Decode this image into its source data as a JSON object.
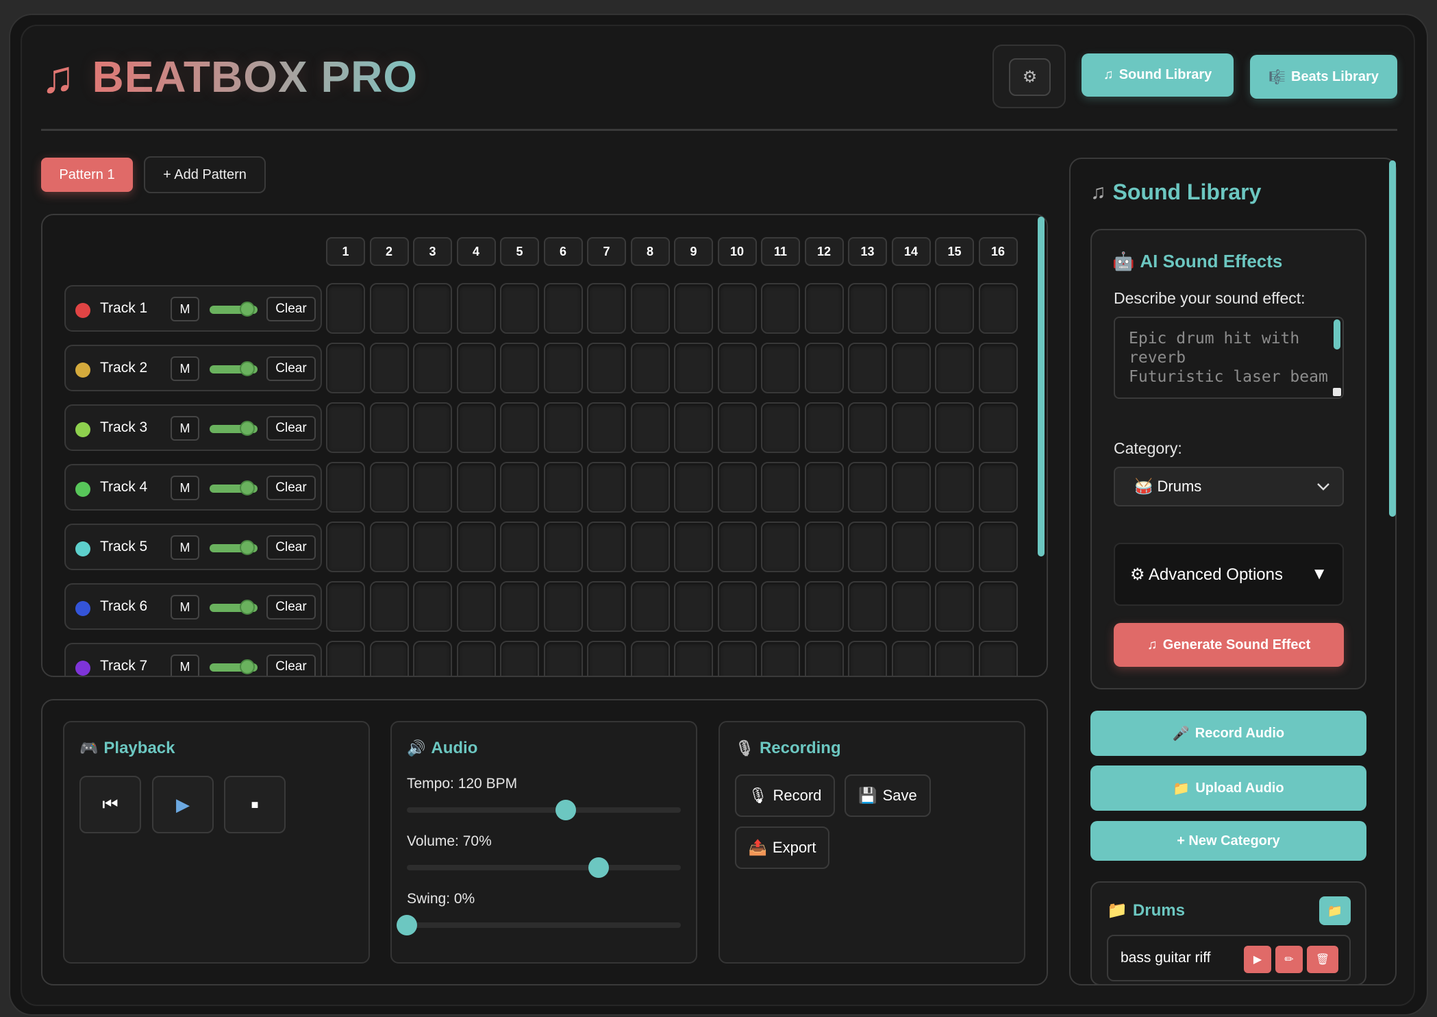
{
  "app": {
    "logo_icon": "♫",
    "title": "BEATBOX PRO"
  },
  "header": {
    "settings_icon": "⚙",
    "sound_library": {
      "icon": "♫",
      "label": "Sound Library"
    },
    "beats_library": {
      "icon": "🎼",
      "label": "Beats Library"
    }
  },
  "patterns": {
    "active": "Pattern 1",
    "add_label": "+ Add Pattern"
  },
  "sequencer": {
    "steps": [
      "1",
      "2",
      "3",
      "4",
      "5",
      "6",
      "7",
      "8",
      "9",
      "10",
      "11",
      "12",
      "13",
      "14",
      "15",
      "16"
    ],
    "mute_label": "M",
    "clear_label": "Clear",
    "tracks": [
      {
        "name": "Track 1",
        "color": "#e04444"
      },
      {
        "name": "Track 2",
        "color": "#d4aa3c"
      },
      {
        "name": "Track 3",
        "color": "#8ed14e"
      },
      {
        "name": "Track 4",
        "color": "#58c65a"
      },
      {
        "name": "Track 5",
        "color": "#5dd0cc"
      },
      {
        "name": "Track 6",
        "color": "#3454d8"
      },
      {
        "name": "Track 7",
        "color": "#7e34d8"
      }
    ]
  },
  "playback": {
    "icon": "🎮",
    "title": "Playback",
    "buttons": {
      "rewind": "⏮",
      "play": "▶",
      "stop": "■"
    }
  },
  "audio": {
    "icon": "🔊",
    "title": "Audio",
    "tempo_label": "Tempo: 120 BPM",
    "tempo_fraction": 0.58,
    "volume_label": "Volume: 70%",
    "volume_fraction": 0.7,
    "swing_label": "Swing: 0%",
    "swing_fraction": 0.0
  },
  "recording": {
    "icon": "🎙",
    "title": "Recording",
    "record": {
      "icon": "🎙",
      "label": "Record"
    },
    "save": {
      "icon": "💾",
      "label": "Save"
    },
    "export": {
      "icon": "📤",
      "label": "Export"
    }
  },
  "side": {
    "title_icon": "♫",
    "title": "Sound Library",
    "ai": {
      "icon": "🤖",
      "title": "AI Sound Effects",
      "describe_label": "Describe your sound effect:",
      "placeholder": "Epic drum hit with reverb\nFuturistic laser beam",
      "category_label": "Category:",
      "category_value": "🥁 Drums",
      "advanced_label": "⚙ Advanced Options",
      "advanced_arrow": "▼",
      "generate": {
        "icon": "♫",
        "label": "Generate Sound Effect"
      }
    },
    "record_audio": {
      "icon": "🎤",
      "label": "Record Audio"
    },
    "upload_audio": {
      "icon": "📁",
      "label": "Upload Audio"
    },
    "new_category": {
      "label": "+ New Category"
    },
    "category": {
      "icon": "📁",
      "name": "Drums",
      "folder_icon": "📁",
      "sounds": [
        {
          "name": "bass guitar riff",
          "play_icon": "▶",
          "edit_icon": "✏",
          "delete_icon": "🗑"
        }
      ]
    }
  }
}
